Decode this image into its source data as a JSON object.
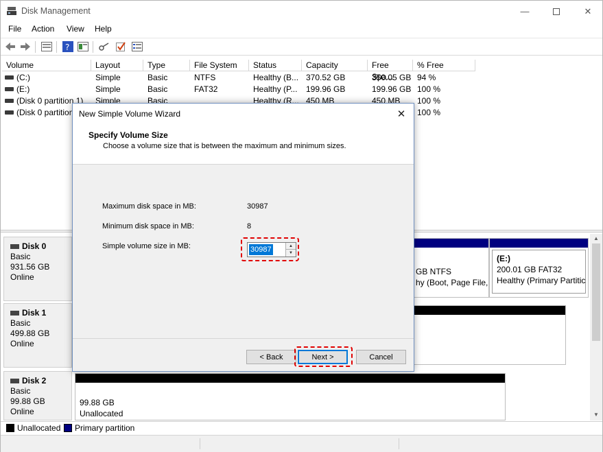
{
  "window": {
    "title": "Disk Management"
  },
  "menu": [
    "File",
    "Action",
    "View",
    "Help"
  ],
  "volume_table": {
    "columns": [
      "Volume",
      "Layout",
      "Type",
      "File System",
      "Status",
      "Capacity",
      "Free Spa...",
      "% Free"
    ],
    "rows": [
      [
        "(C:)",
        "Simple",
        "Basic",
        "NTFS",
        "Healthy (B...",
        "370.52 GB",
        "350.05 GB",
        "94 %"
      ],
      [
        "(E:)",
        "Simple",
        "Basic",
        "FAT32",
        "Healthy (P...",
        "199.96 GB",
        "199.96 GB",
        "100 %"
      ],
      [
        "(Disk 0 partition 1)",
        "Simple",
        "Basic",
        "",
        "Healthy (R...",
        "450 MB",
        "450 MB",
        "100 %"
      ],
      [
        "(Disk 0 partition 4)",
        "Simple",
        "Basic",
        "",
        "",
        "",
        "",
        "100 %"
      ]
    ]
  },
  "disks": [
    {
      "name": "Disk 0",
      "type": "Basic",
      "size": "931.56 GB",
      "state": "Online"
    },
    {
      "name": "Disk 1",
      "type": "Basic",
      "size": "499.88 GB",
      "state": "Online"
    },
    {
      "name": "Disk 2",
      "type": "Basic",
      "size": "99.88 GB",
      "state": "Online"
    }
  ],
  "partitions": {
    "disk0_c_line1": "GB NTFS",
    "disk0_c_line2": "hy (Boot, Page File, C",
    "disk0_e_name": "(E:)",
    "disk0_e_line1": "200.01 GB FAT32",
    "disk0_e_line2": "Healthy (Primary Partitic",
    "disk2_unalloc_size": "99.88 GB",
    "disk2_unalloc_label": "Unallocated"
  },
  "legend": [
    {
      "label": "Unallocated",
      "color": "#000000"
    },
    {
      "label": "Primary partition",
      "color": "#000080"
    }
  ],
  "colors": {
    "primary": "#000080",
    "unallocated": "#000000",
    "highlight": "#e00000",
    "accent": "#0078d7"
  },
  "dialog": {
    "title": "New Simple Volume Wizard",
    "heading": "Specify Volume Size",
    "subheading": "Choose a volume size that is between the maximum and minimum sizes.",
    "max_label": "Maximum disk space in MB:",
    "max_value": "30987",
    "min_label": "Minimum disk space in MB:",
    "min_value": "8",
    "size_label": "Simple volume size in MB:",
    "size_value": "30987",
    "back_label": "< Back",
    "next_label": "Next >",
    "cancel_label": "Cancel"
  }
}
